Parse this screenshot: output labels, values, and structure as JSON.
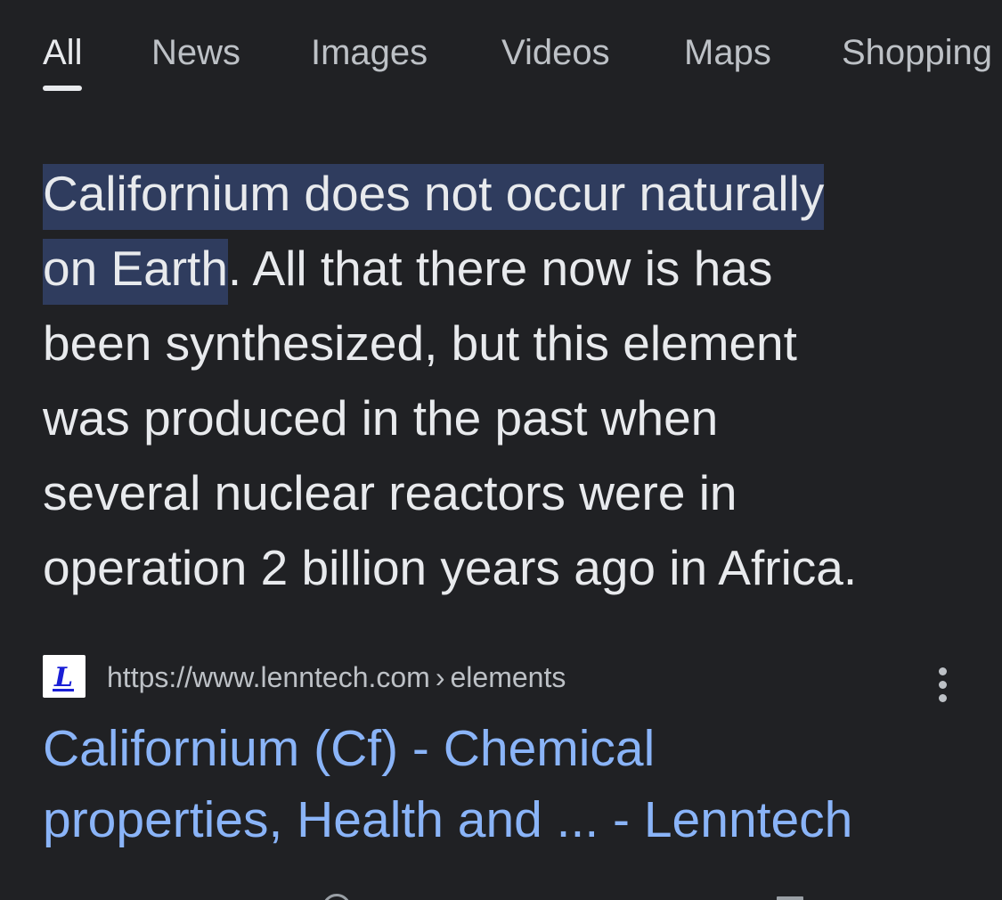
{
  "tabs": [
    {
      "label": "All",
      "active": true
    },
    {
      "label": "News"
    },
    {
      "label": "Images"
    },
    {
      "label": "Videos"
    },
    {
      "label": "Maps"
    },
    {
      "label": "Shopping"
    }
  ],
  "snippet": {
    "highlight_line1": "Californium does not occur naturally",
    "highlight_line2": "on Earth",
    "rest_line2": ". All that there now is has",
    "line3": "been synthesized, but this element",
    "line4": "was produced in the past when",
    "line5": "several nuclear reactors were in",
    "line6": "operation 2 billion years ago in Africa."
  },
  "result": {
    "favicon_icon": "lenntech-logo-icon",
    "favicon_letter": "L",
    "url_domain": "https://www.lenntech.com",
    "url_separator": "›",
    "url_path": "elements",
    "title_line1": "Californium (Cf) - Chemical",
    "title_line2": "properties, Health and ... - Lenntech",
    "menu_icon": "more-vert-icon"
  },
  "colors": {
    "background": "#202124",
    "text": "#e8eaed",
    "muted": "#bdc1c6",
    "link": "#8ab4f8",
    "highlight": "#2f3c5e"
  }
}
